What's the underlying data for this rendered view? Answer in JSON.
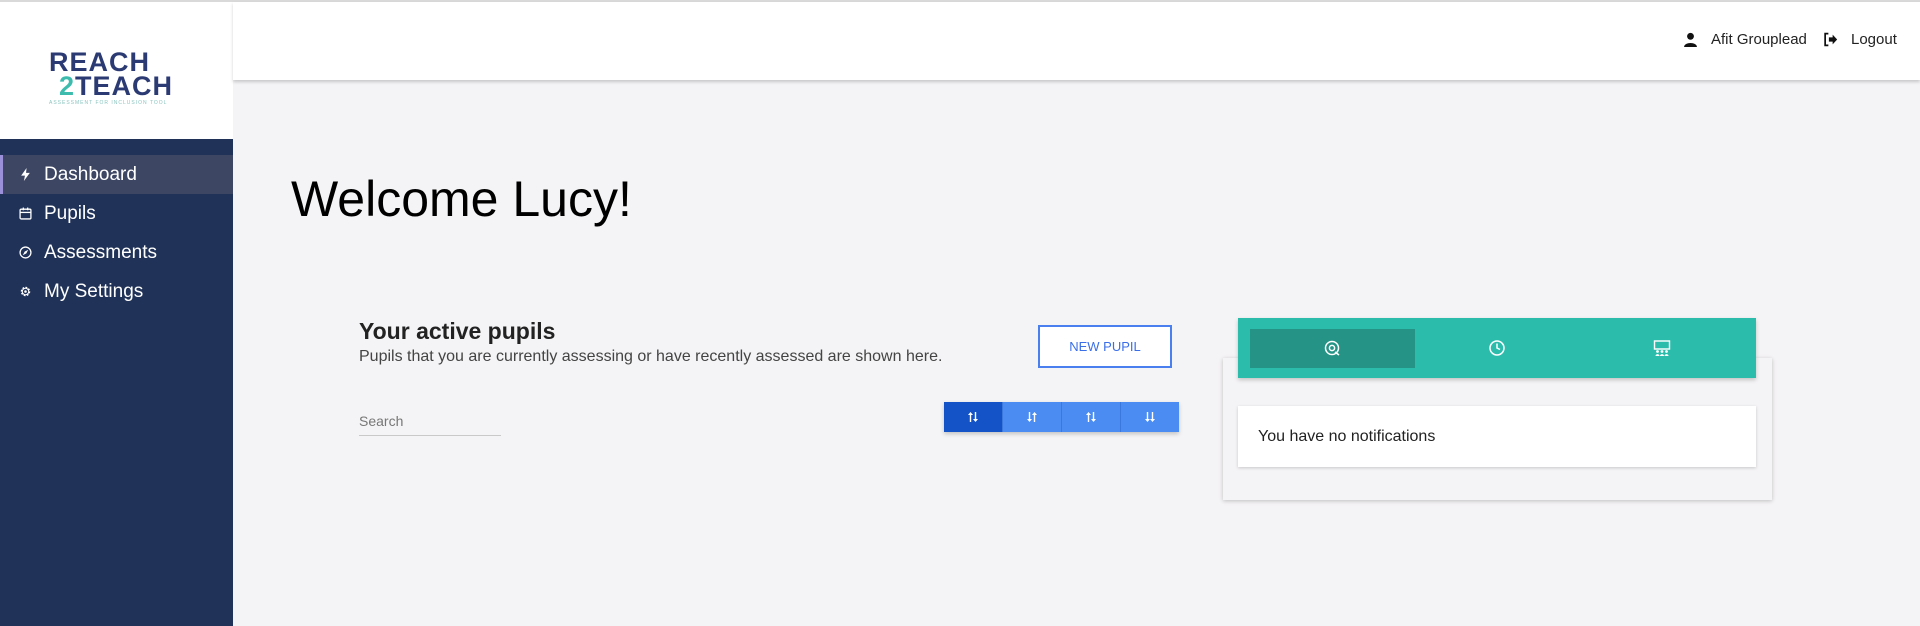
{
  "logo": {
    "line1": "REACH",
    "line2_num": "2",
    "line2_word": "TEACH",
    "tagline": "ASSESSMENT FOR INCLUSION TOOL"
  },
  "sidebar": {
    "items": [
      {
        "label": "Dashboard",
        "icon": "lightning-icon",
        "active": true
      },
      {
        "label": "Pupils",
        "icon": "calendar-icon",
        "active": false
      },
      {
        "label": "Assessments",
        "icon": "compass-icon",
        "active": false
      },
      {
        "label": "My Settings",
        "icon": "gear-icon",
        "active": false
      }
    ]
  },
  "header": {
    "user_name": "Afit Grouplead",
    "logout_label": "Logout"
  },
  "main": {
    "welcome": "Welcome Lucy!",
    "pupils_title": "Your active pupils",
    "pupils_subtitle": "Pupils that you are currently assessing or have recently assessed are shown here.",
    "new_pupil_label": "NEW PUPIL",
    "search_placeholder": "Search",
    "sort_buttons": [
      {
        "icon": "sort-asc-icon",
        "active": true
      },
      {
        "icon": "sort-desc-icon",
        "active": false
      },
      {
        "icon": "sort-swap-icon",
        "active": false
      },
      {
        "icon": "sort-down-icon",
        "active": false
      }
    ]
  },
  "notifications": {
    "tabs": [
      {
        "icon": "notification-bell-icon",
        "active": true
      },
      {
        "icon": "clock-icon",
        "active": false
      },
      {
        "icon": "classroom-icon",
        "active": false
      }
    ],
    "empty_message": "You have no notifications"
  },
  "colors": {
    "sidebar_bg": "#203258",
    "accent_teal": "#2cbcab",
    "accent_blue": "#4a8cf2",
    "active_blue": "#1353c7",
    "page_bg": "#f4f3f5"
  }
}
